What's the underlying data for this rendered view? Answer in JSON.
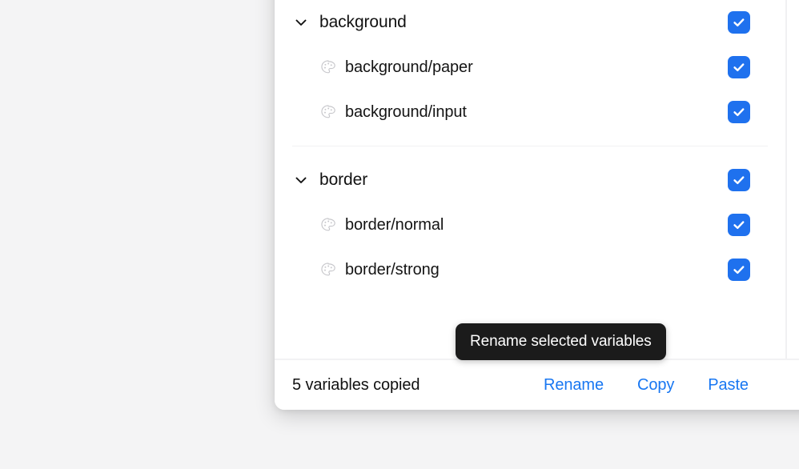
{
  "theme": {
    "page_background": "#f4f4f5",
    "panel_background": "#ffffff",
    "checkbox_accent": "#1f71ee",
    "link_color": "#1877f2",
    "tooltip_background": "#1b1b1b",
    "tooltip_text": "#ffffff",
    "divider_color": "#f1f1f3",
    "text_primary": "#121212"
  },
  "panel": {
    "groups": [
      {
        "name": "background",
        "expand_icon": "chevron-down-icon",
        "checked": true,
        "children": [
          {
            "name": "background/paper",
            "icon": "palette-icon",
            "checked": true
          },
          {
            "name": "background/input",
            "icon": "palette-icon",
            "checked": true
          }
        ]
      },
      {
        "name": "border",
        "expand_icon": "chevron-down-icon",
        "checked": true,
        "children": [
          {
            "name": "border/normal",
            "icon": "palette-icon",
            "checked": true
          },
          {
            "name": "border/strong",
            "icon": "palette-icon",
            "checked": true
          }
        ]
      }
    ]
  },
  "tooltip": {
    "text": "Rename selected variables"
  },
  "footer": {
    "status": "5 variables copied",
    "actions": [
      {
        "label": "Rename"
      },
      {
        "label": "Copy"
      },
      {
        "label": "Paste"
      }
    ]
  }
}
